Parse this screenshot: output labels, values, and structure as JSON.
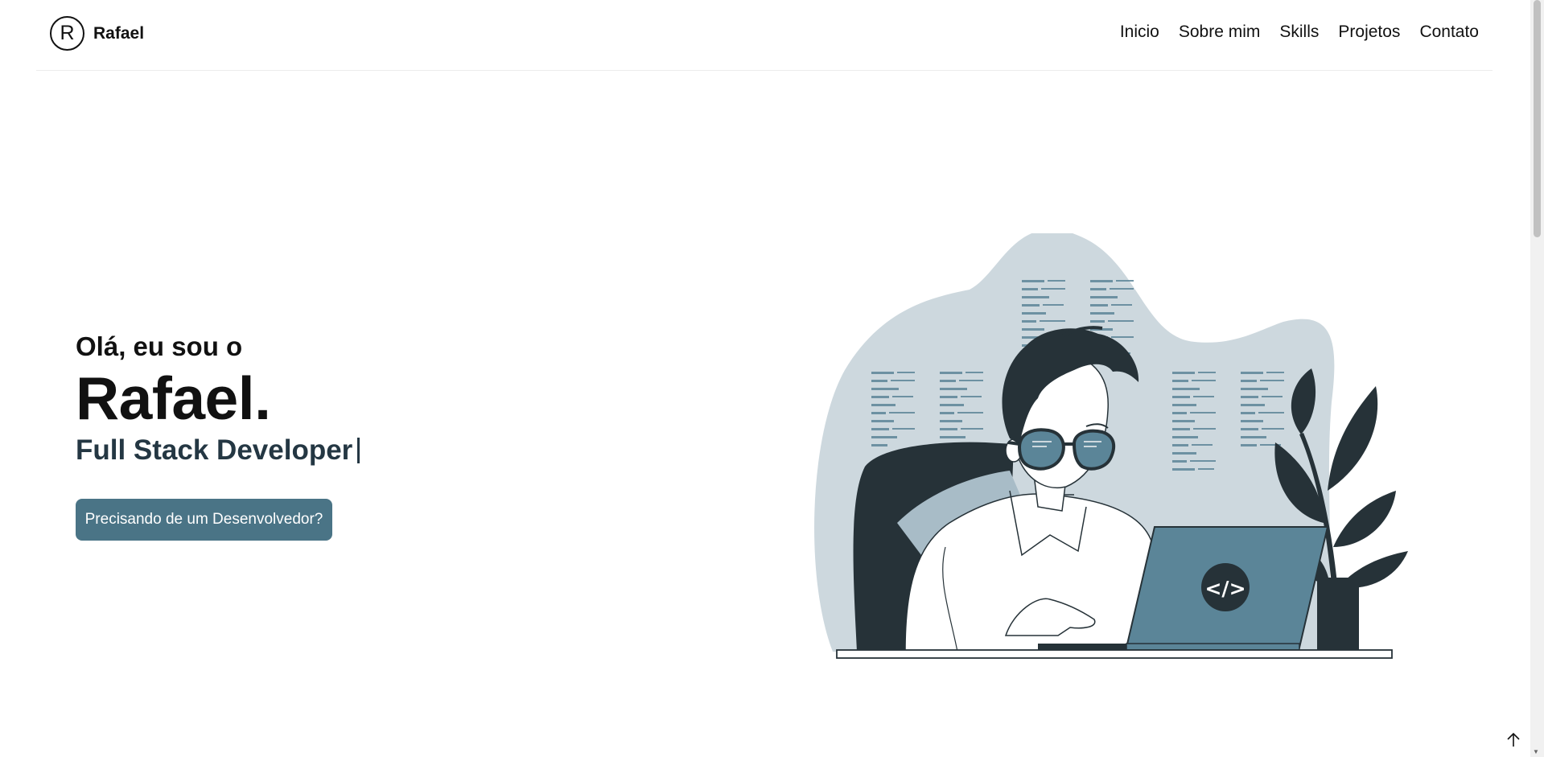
{
  "brand": {
    "logo_letter": "R",
    "name": "Rafael"
  },
  "nav": [
    {
      "label": "Inicio"
    },
    {
      "label": "Sobre mim"
    },
    {
      "label": "Skills"
    },
    {
      "label": "Projetos"
    },
    {
      "label": "Contato"
    }
  ],
  "hero": {
    "greeting": "Olá, eu sou o",
    "name": "Rafael.",
    "role": "Full Stack Developer",
    "cta_label": "Precisando de um Desenvolvedor?"
  },
  "illustration": {
    "laptop_code_symbol": "</>"
  },
  "icons": {
    "back_to_top": "arrow-up-icon"
  },
  "colors": {
    "accent": "#4a7486",
    "dark": "#263238",
    "illustration_bg": "#cdd8de",
    "laptop": "#5b8598",
    "role_text": "#243743"
  }
}
